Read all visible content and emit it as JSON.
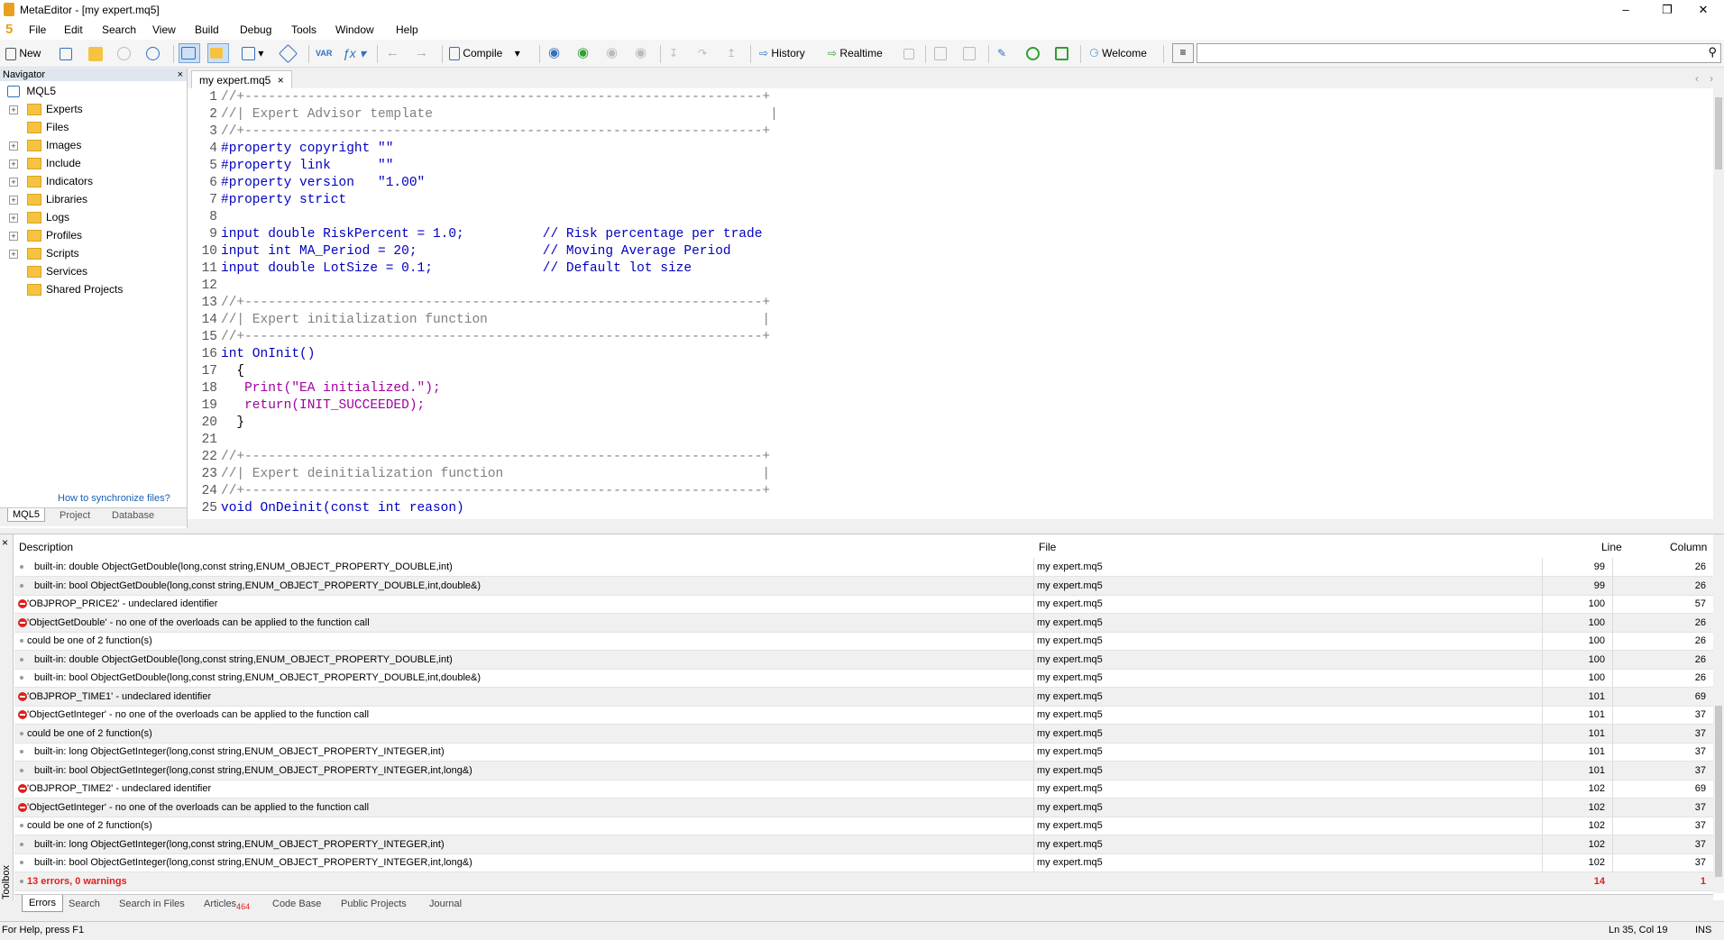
{
  "window": {
    "title": "MetaEditor - [my expert.mq5]"
  },
  "menu": [
    "File",
    "Edit",
    "Search",
    "View",
    "Build",
    "Debug",
    "Tools",
    "Window",
    "Help"
  ],
  "toolbar": {
    "new_label": "New",
    "compile_label": "Compile",
    "history_label": "History",
    "realtime_label": "Realtime",
    "welcome_label": "Welcome"
  },
  "navigator": {
    "title": "Navigator",
    "root": "MQL5",
    "items": [
      "Experts",
      "Files",
      "Images",
      "Include",
      "Indicators",
      "Libraries",
      "Logs",
      "Profiles",
      "Scripts",
      "Services",
      "Shared Projects"
    ],
    "sync_link": "How to synchronize files?",
    "tabs": [
      "MQL5",
      "Project",
      "Database"
    ]
  },
  "editor": {
    "tab": "my expert.mq5",
    "lines": [
      {
        "n": "1",
        "t": "//+------------------------------------------------------------------+"
      },
      {
        "n": "2",
        "t": "//| Expert Advisor template                                           |"
      },
      {
        "n": "3",
        "t": "//+------------------------------------------------------------------+"
      },
      {
        "n": "4",
        "t": "#property copyright \"\""
      },
      {
        "n": "5",
        "t": "#property link      \"\""
      },
      {
        "n": "6",
        "t": "#property version   \"1.00\""
      },
      {
        "n": "7",
        "t": "#property strict"
      },
      {
        "n": "8",
        "t": ""
      },
      {
        "n": "9",
        "t": "input double RiskPercent = 1.0;          // Risk percentage per trade"
      },
      {
        "n": "10",
        "t": "input int MA_Period = 20;                // Moving Average Period"
      },
      {
        "n": "11",
        "t": "input double LotSize = 0.1;              // Default lot size"
      },
      {
        "n": "12",
        "t": ""
      },
      {
        "n": "13",
        "t": "//+------------------------------------------------------------------+"
      },
      {
        "n": "14",
        "t": "//| Expert initialization function                                   |"
      },
      {
        "n": "15",
        "t": "//+------------------------------------------------------------------+"
      },
      {
        "n": "16",
        "t": "int OnInit()"
      },
      {
        "n": "17",
        "t": "  {"
      },
      {
        "n": "18",
        "t": "   Print(\"EA initialized.\");"
      },
      {
        "n": "19",
        "t": "   return(INIT_SUCCEEDED);"
      },
      {
        "n": "20",
        "t": "  }"
      },
      {
        "n": "21",
        "t": ""
      },
      {
        "n": "22",
        "t": "//+------------------------------------------------------------------+"
      },
      {
        "n": "23",
        "t": "//| Expert deinitialization function                                 |"
      },
      {
        "n": "24",
        "t": "//+------------------------------------------------------------------+"
      },
      {
        "n": "25",
        "t": "void OnDeinit(const int reason)"
      }
    ]
  },
  "errors": {
    "headers": {
      "description": "Description",
      "file": "File",
      "line": "Line",
      "column": "Column"
    },
    "rows": [
      {
        "type": "info",
        "d": "built-in: double ObjectGetDouble(long,const string,ENUM_OBJECT_PROPERTY_DOUBLE,int)",
        "f": "my expert.mq5",
        "l": "99",
        "c": "26"
      },
      {
        "type": "info",
        "d": "built-in: bool ObjectGetDouble(long,const string,ENUM_OBJECT_PROPERTY_DOUBLE,int,double&)",
        "f": "my expert.mq5",
        "l": "99",
        "c": "26"
      },
      {
        "type": "error",
        "d": "'OBJPROP_PRICE2' - undeclared identifier",
        "f": "my expert.mq5",
        "l": "100",
        "c": "57"
      },
      {
        "type": "error",
        "d": "'ObjectGetDouble' - no one of the overloads can be applied to the function call",
        "f": "my expert.mq5",
        "l": "100",
        "c": "26"
      },
      {
        "type": "info",
        "d": "could be one of 2 function(s)",
        "f": "my expert.mq5",
        "l": "100",
        "c": "26"
      },
      {
        "type": "info",
        "d": "built-in: double ObjectGetDouble(long,const string,ENUM_OBJECT_PROPERTY_DOUBLE,int)",
        "f": "my expert.mq5",
        "l": "100",
        "c": "26"
      },
      {
        "type": "info",
        "d": "built-in: bool ObjectGetDouble(long,const string,ENUM_OBJECT_PROPERTY_DOUBLE,int,double&)",
        "f": "my expert.mq5",
        "l": "100",
        "c": "26"
      },
      {
        "type": "error",
        "d": "'OBJPROP_TIME1' - undeclared identifier",
        "f": "my expert.mq5",
        "l": "101",
        "c": "69"
      },
      {
        "type": "error",
        "d": "'ObjectGetInteger' - no one of the overloads can be applied to the function call",
        "f": "my expert.mq5",
        "l": "101",
        "c": "37"
      },
      {
        "type": "info",
        "d": "could be one of 2 function(s)",
        "f": "my expert.mq5",
        "l": "101",
        "c": "37"
      },
      {
        "type": "info",
        "d": "built-in: long ObjectGetInteger(long,const string,ENUM_OBJECT_PROPERTY_INTEGER,int)",
        "f": "my expert.mq5",
        "l": "101",
        "c": "37"
      },
      {
        "type": "info",
        "d": "built-in: bool ObjectGetInteger(long,const string,ENUM_OBJECT_PROPERTY_INTEGER,int,long&)",
        "f": "my expert.mq5",
        "l": "101",
        "c": "37"
      },
      {
        "type": "error",
        "d": "'OBJPROP_TIME2' - undeclared identifier",
        "f": "my expert.mq5",
        "l": "102",
        "c": "69"
      },
      {
        "type": "error",
        "d": "'ObjectGetInteger' - no one of the overloads can be applied to the function call",
        "f": "my expert.mq5",
        "l": "102",
        "c": "37"
      },
      {
        "type": "info",
        "d": "could be one of 2 function(s)",
        "f": "my expert.mq5",
        "l": "102",
        "c": "37"
      },
      {
        "type": "info",
        "d": "built-in: long ObjectGetInteger(long,const string,ENUM_OBJECT_PROPERTY_INTEGER,int)",
        "f": "my expert.mq5",
        "l": "102",
        "c": "37"
      },
      {
        "type": "info",
        "d": "built-in: bool ObjectGetInteger(long,const string,ENUM_OBJECT_PROPERTY_INTEGER,int,long&)",
        "f": "my expert.mq5",
        "l": "102",
        "c": "37"
      }
    ],
    "summary": {
      "d": "13 errors, 0 warnings",
      "l": "14",
      "c": "1"
    }
  },
  "toolbox": {
    "side_label": "Toolbox",
    "tabs": [
      "Errors",
      "Search",
      "Search in Files",
      "Articles",
      "Code Base",
      "Public Projects",
      "Journal"
    ],
    "articles_badge": "464"
  },
  "status": {
    "help": "For Help, press F1",
    "position": "Ln 35, Col 19",
    "mode": "INS"
  },
  "colors": {
    "error": "#e02020",
    "accent": "#0078d7",
    "keyword": "#0000c0"
  }
}
